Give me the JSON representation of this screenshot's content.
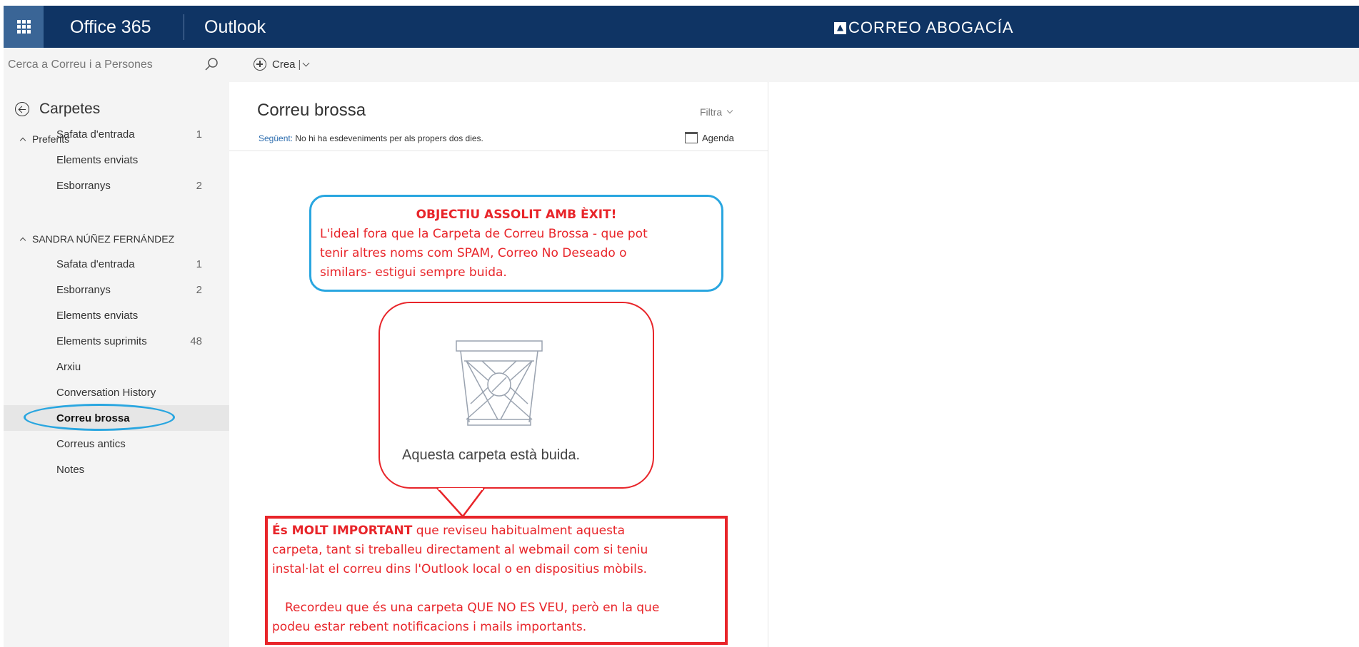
{
  "topbar": {
    "brand": "Office 365",
    "app": "Outlook",
    "tenant": "CORREO ABOGACÍA"
  },
  "toolbar": {
    "search_placeholder": "Cerca a Correu i a Persones",
    "new_label": "Crea",
    "new_sep": "|"
  },
  "sidebar": {
    "header": "Carpetes",
    "favorites_label": "Preferits",
    "favorites": [
      {
        "label": "Safata d'entrada",
        "count": "1"
      },
      {
        "label": "Elements enviats",
        "count": ""
      },
      {
        "label": "Esborranys",
        "count": "2"
      }
    ],
    "account_label": "SANDRA NÚÑEZ FERNÁNDEZ",
    "account_items": [
      {
        "label": "Safata d'entrada",
        "count": "1"
      },
      {
        "label": "Esborranys",
        "count": "2"
      },
      {
        "label": "Elements enviats",
        "count": ""
      },
      {
        "label": "Elements suprimits",
        "count": "48"
      },
      {
        "label": "Arxiu",
        "count": ""
      },
      {
        "label": "Conversation History",
        "count": ""
      },
      {
        "label": "Correu brossa",
        "count": ""
      },
      {
        "label": "Correus antics",
        "count": ""
      },
      {
        "label": "Notes",
        "count": ""
      }
    ]
  },
  "list": {
    "title": "Correu brossa",
    "filter_label": "Filtra",
    "next_key": "Següent:",
    "next_text": "No hi ha esdeveniments per als propers dos dies.",
    "agenda_label": "Agenda",
    "empty_text": "Aquesta carpeta està buida."
  },
  "annotations": {
    "top_title": "OBJECTIU ASSOLIT AMB ÈXIT!",
    "top_line1": "L'ideal fora que la Carpeta de Correu Brossa - que pot",
    "top_line2": "tenir altres noms com SPAM, Correo No Deseado o",
    "top_line3": "similars- estigui sempre buida.",
    "box_bold": "És MOLT IMPORTANT",
    "box_line1_rest": " que reviseu habitualment aquesta",
    "box_line2": "carpeta, tant si treballeu directament al webmail com si teniu",
    "box_line3": "instal·lat el correu dins l'Outlook local o en dispositius mòbils.",
    "box_p2_line1": "Recordeu que és una carpeta QUE NO ES VEU, però en la que",
    "box_p2_line2": "podeu estar rebent notificacions i mails importants."
  },
  "colors": {
    "topbar": "#0f3464",
    "waffle": "#3a6596",
    "annotation_red": "#e8252a",
    "annotation_blue": "#29a6e0"
  },
  "icons": [
    "app-launcher-icon",
    "search-icon",
    "add-circle-icon",
    "chevron-down-icon",
    "back-arrow-icon",
    "calendar-icon",
    "empty-junk-bin-icon"
  ]
}
